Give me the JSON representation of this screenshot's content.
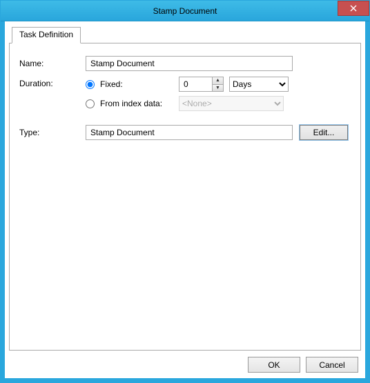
{
  "window": {
    "title": "Stamp Document"
  },
  "tabs": {
    "definition": "Task Definition"
  },
  "labels": {
    "name": "Name:",
    "duration": "Duration:",
    "type": "Type:"
  },
  "name_value": "Stamp Document",
  "duration": {
    "fixed_label": "Fixed:",
    "fixed_selected": true,
    "fixed_value": "0",
    "unit_selected": "Days",
    "unit_options": [
      "Days"
    ],
    "index_label": "From index data:",
    "index_selected": false,
    "index_value": "<None>"
  },
  "type_value": "Stamp Document",
  "buttons": {
    "edit": "Edit...",
    "ok": "OK",
    "cancel": "Cancel"
  }
}
